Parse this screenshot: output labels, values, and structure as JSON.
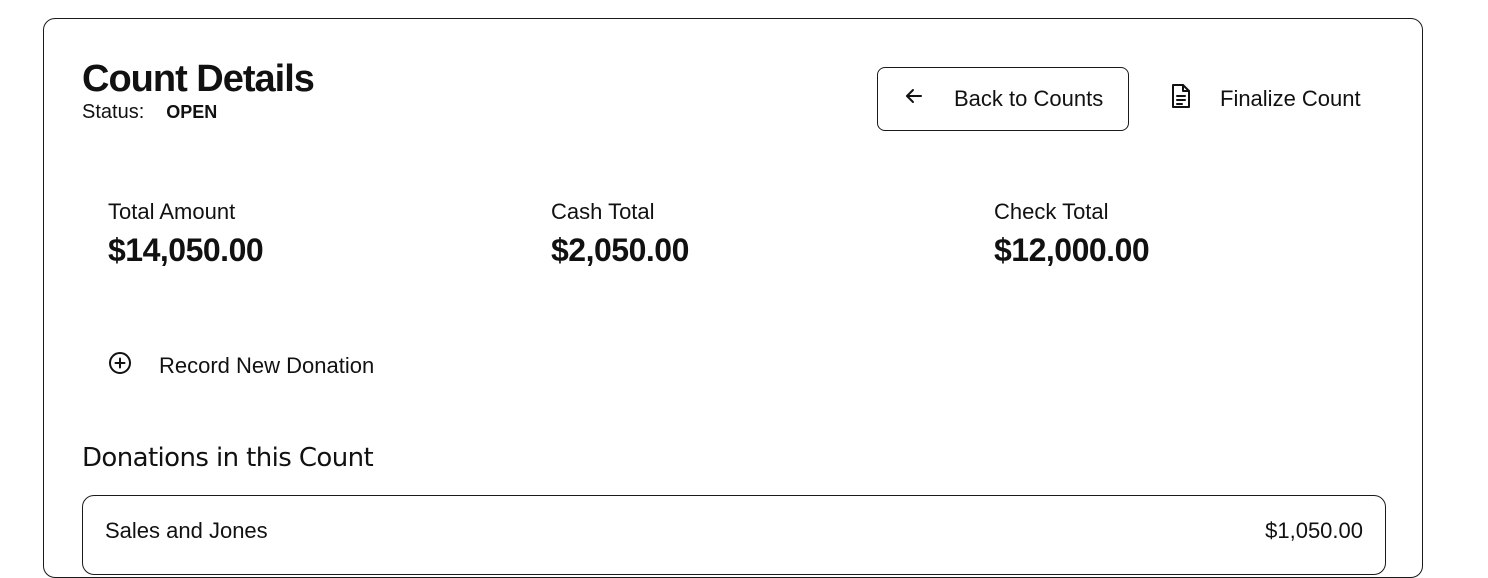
{
  "header": {
    "title": "Count Details",
    "status_label": "Status:",
    "status_value": "OPEN"
  },
  "actions": {
    "back_label": "Back to Counts",
    "finalize_label": "Finalize Count",
    "record_label": "Record New Donation"
  },
  "stats": [
    {
      "label": "Total Amount",
      "value": "$14,050.00"
    },
    {
      "label": "Cash Total",
      "value": "$2,050.00"
    },
    {
      "label": "Check Total",
      "value": "$12,000.00"
    }
  ],
  "donations": {
    "section_title": "Donations in this Count",
    "rows": [
      {
        "name": "Sales and Jones",
        "amount": "$1,050.00"
      }
    ]
  },
  "icons": {
    "back": "arrow-left-icon",
    "finalize": "document-icon",
    "record": "plus-circle-icon"
  }
}
